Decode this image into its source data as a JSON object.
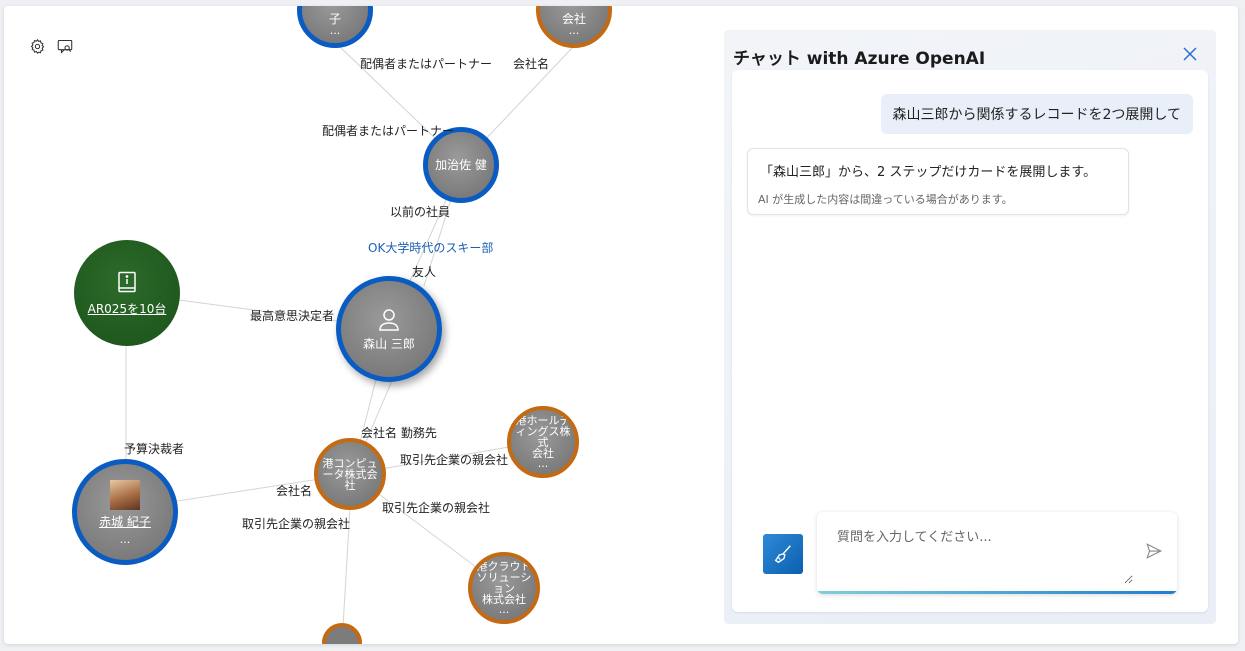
{
  "graph": {
    "toolbar": {
      "settings_icon": "gear-icon",
      "feedback_icon": "feedback-icon"
    },
    "nodes": {
      "top_left": {
        "label": "子",
        "more": "..."
      },
      "top_right": {
        "label": "会社",
        "more": "..."
      },
      "kajisa": {
        "label": "加治佐 健"
      },
      "ar025": {
        "label": "AR025を10台",
        "icon": "info-book-icon"
      },
      "moriyama": {
        "label": "森山 三郎",
        "icon": "person-icon"
      },
      "minato_holdings": {
        "line1": "港ホールデ",
        "line2": "ィングス株式",
        "line3": "会社",
        "more": "..."
      },
      "minato_computer": {
        "line1": "港コンピュ",
        "line2": "ータ株式会",
        "line3": "社"
      },
      "akagi": {
        "label": "赤城 紀子",
        "more": "...",
        "photo": "avatar-photo"
      },
      "minato_cloud": {
        "line1": "港クラウド",
        "line2": "ソリューション",
        "line3": "株式会社",
        "more": "..."
      }
    },
    "edge_labels": {
      "spouse1": "配偶者またはパートナー",
      "company1": "会社名",
      "spouse2": "配偶者またはパートナー",
      "former_colleague": "以前の社員",
      "ok_ski": "OK大学時代のスキー部",
      "friend": "友人",
      "decision_maker": "最高意思決定者",
      "employer": "会社名 勤務先",
      "parent_company1": "取引先企業の親会社",
      "budget": "予算決裁者",
      "company2": "会社名",
      "parent_company2": "取引先企業の親会社",
      "parent_company3": "取引先企業の親会社"
    }
  },
  "chat": {
    "title": "チャット with Azure OpenAI",
    "close_icon": "close-icon",
    "user_message": "森山三郎から関係するレコードを2つ展開して",
    "ai_message": "「森山三郎」から、2 ステップだけカードを展開します。",
    "ai_disclaimer": "AI が生成した内容は間違っている場合があります。",
    "clear_icon": "broom-icon",
    "input_placeholder": "質問を入力してください...",
    "send_icon": "send-icon"
  },
  "colors": {
    "person_border": "#0a5cc2",
    "company_border": "#c46a12",
    "opportunity_fill": "#1f561d",
    "link_text": "#1a5fb4"
  }
}
